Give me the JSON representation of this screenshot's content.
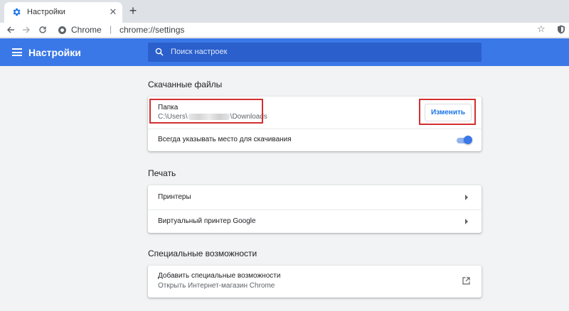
{
  "browser": {
    "tab_title": "Настройки",
    "tab_close": "✕",
    "new_tab": "+",
    "omnibox_chip": "Chrome",
    "omnibox_separator": "|",
    "omnibox_url": "chrome://settings",
    "icons": [
      "back-icon",
      "forward-icon",
      "reload-icon",
      "star-icon",
      "shield-icon"
    ]
  },
  "header": {
    "title": "Настройки",
    "search_placeholder": "Поиск настроек",
    "bg_color": "#3b78e7"
  },
  "downloads": {
    "section_title": "Скачанные файлы",
    "folder_label": "Папка",
    "folder_path_start": "C:\\Users\\",
    "folder_path_end": "\\Downloads",
    "change_button": "Изменить",
    "ask_location_label": "Всегда указывать место для скачивания",
    "ask_location_enabled": true
  },
  "print": {
    "section_title": "Печать",
    "items": [
      {
        "label": "Принтеры"
      },
      {
        "label": "Виртуальный принтер Google"
      }
    ]
  },
  "accessibility": {
    "section_title": "Специальные возможности",
    "add_label": "Добавить специальные возможности",
    "add_sublabel": "Открыть Интернет-магазин Chrome"
  },
  "highlight_color": "#d32f2f"
}
